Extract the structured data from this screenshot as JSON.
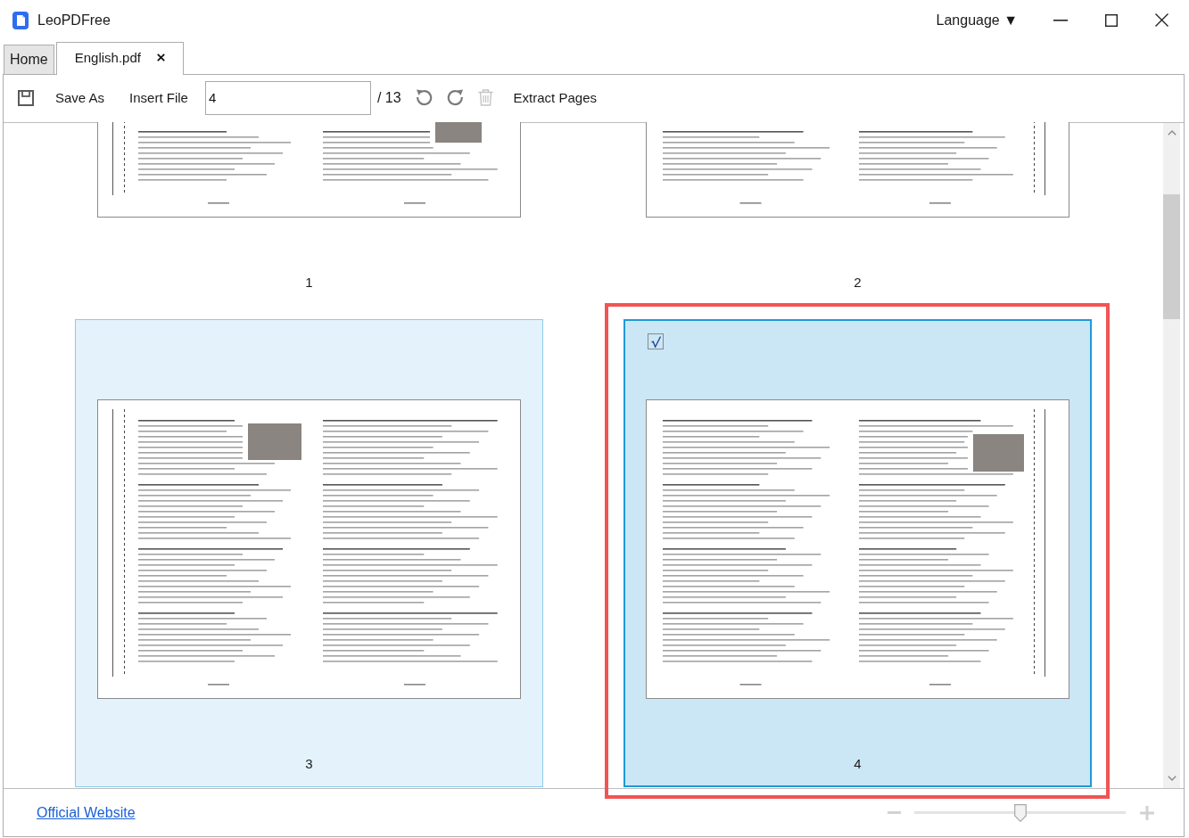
{
  "app": {
    "title": "LeoPDFree",
    "language_menu": "Language ▼"
  },
  "tabs": [
    {
      "label": "Home",
      "selected": false,
      "closable": false
    },
    {
      "label": "English.pdf",
      "selected": true,
      "closable": true
    }
  ],
  "toolbar": {
    "save_as": "Save As",
    "insert_file": "Insert File",
    "page_field": "4",
    "page_total": "/ 13",
    "tools": [
      {
        "kind": "rotate-left",
        "disabled": false
      },
      {
        "kind": "rotate-right",
        "disabled": false
      },
      {
        "kind": "delete",
        "disabled": true
      }
    ],
    "extract_pages": "Extract Pages"
  },
  "pages": [
    {
      "number": "1",
      "selected": false,
      "hovered": false
    },
    {
      "number": "2",
      "selected": false,
      "hovered": false
    },
    {
      "number": "3",
      "selected": false,
      "hovered": true
    },
    {
      "number": "4",
      "selected": true,
      "hovered": false
    }
  ],
  "highlight_frame": true,
  "footer": {
    "link": "Official Website",
    "zoom": {
      "level": 0.5
    }
  }
}
